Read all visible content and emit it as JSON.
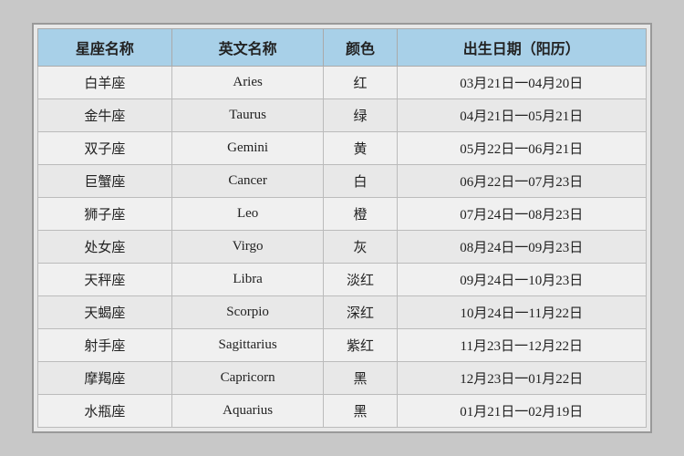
{
  "table": {
    "headers": {
      "chinese_name": "星座名称",
      "english_name": "英文名称",
      "color": "颜色",
      "birth_date": "出生日期（阳历）"
    },
    "rows": [
      {
        "chinese": "白羊座",
        "english": "Aries",
        "color": "红",
        "date": "03月21日一04月20日"
      },
      {
        "chinese": "金牛座",
        "english": "Taurus",
        "color": "绿",
        "date": "04月21日一05月21日"
      },
      {
        "chinese": "双子座",
        "english": "Gemini",
        "color": "黄",
        "date": "05月22日一06月21日"
      },
      {
        "chinese": "巨蟹座",
        "english": "Cancer",
        "color": "白",
        "date": "06月22日一07月23日"
      },
      {
        "chinese": "狮子座",
        "english": "Leo",
        "color": "橙",
        "date": "07月24日一08月23日"
      },
      {
        "chinese": "处女座",
        "english": "Virgo",
        "color": "灰",
        "date": "08月24日一09月23日"
      },
      {
        "chinese": "天秤座",
        "english": "Libra",
        "color": "淡红",
        "date": "09月24日一10月23日"
      },
      {
        "chinese": "天蝎座",
        "english": "Scorpio",
        "color": "深红",
        "date": "10月24日一11月22日"
      },
      {
        "chinese": "射手座",
        "english": "Sagittarius",
        "color": "紫红",
        "date": "11月23日一12月22日"
      },
      {
        "chinese": "摩羯座",
        "english": "Capricorn",
        "color": "黑",
        "date": "12月23日一01月22日"
      },
      {
        "chinese": "水瓶座",
        "english": "Aquarius",
        "color": "黑",
        "date": "01月21日一02月19日"
      }
    ]
  }
}
